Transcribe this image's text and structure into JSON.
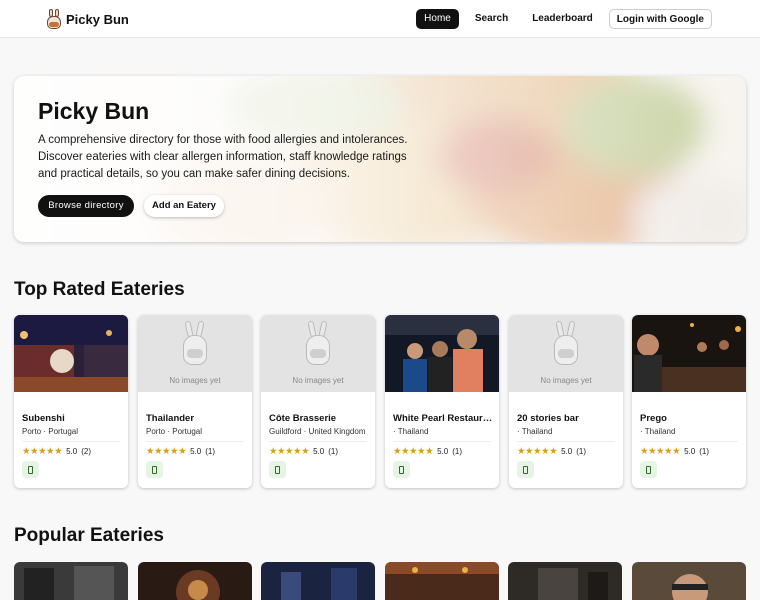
{
  "header": {
    "brand": "Picky Bun",
    "nav": {
      "home": "Home",
      "search": "Search",
      "leaderboard": "Leaderboard",
      "login": "Login with Google"
    }
  },
  "hero": {
    "title": "Picky Bun",
    "description": "A comprehensive directory for those with food allergies and intolerances. Discover eateries with clear allergen information, staff knowledge ratings and practical details, so you can make safer dining decisions.",
    "browse_label": "Browse directory",
    "add_label": "Add an Eatery"
  },
  "top_rated": {
    "title": "Top Rated Eateries",
    "placeholder_text": "No images yet",
    "cards": [
      {
        "name": "Subenshi",
        "location": "Porto · Portugal",
        "rating": "5.0",
        "count": "(2)",
        "stars": "★★★★★",
        "has_image": true
      },
      {
        "name": "Thailander",
        "location": "Porto · Portugal",
        "rating": "5.0",
        "count": "(1)",
        "stars": "★★★★★",
        "has_image": false
      },
      {
        "name": "Côte Brasserie",
        "location": "Guildford · United Kingdom",
        "rating": "5.0",
        "count": "(1)",
        "stars": "★★★★★",
        "has_image": false
      },
      {
        "name": "White Pearl Restauran...",
        "location": "· Thailand",
        "rating": "5.0",
        "count": "(1)",
        "stars": "★★★★★",
        "has_image": true
      },
      {
        "name": "20 stories bar",
        "location": "· Thailand",
        "rating": "5.0",
        "count": "(1)",
        "stars": "★★★★★",
        "has_image": false
      },
      {
        "name": "Prego",
        "location": "· Thailand",
        "rating": "5.0",
        "count": "(1)",
        "stars": "★★★★★",
        "has_image": true
      }
    ]
  },
  "popular": {
    "title": "Popular Eateries"
  },
  "icons": {
    "brand": "bunny-logo-icon",
    "tag": "phone-icon",
    "rating": "star-icon",
    "placeholder": "bunny-placeholder-icon"
  },
  "colors": {
    "accent": "#111111",
    "star": "#d4a017",
    "tag_bg": "#e6f4e4",
    "tag_fg": "#2f6a2a"
  }
}
